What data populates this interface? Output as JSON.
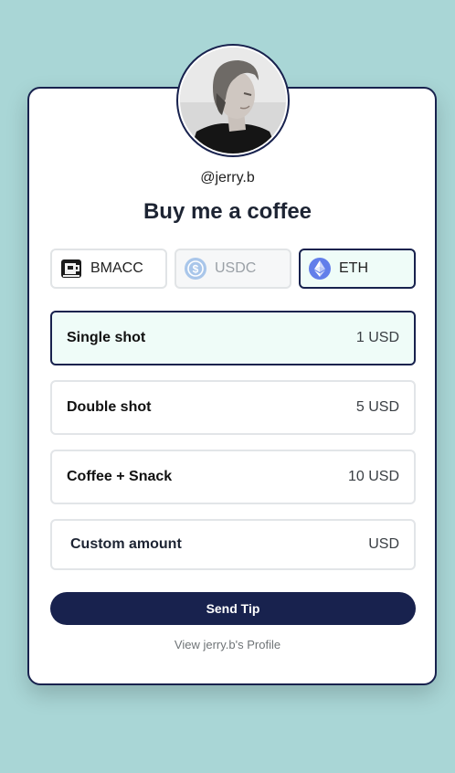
{
  "profile": {
    "handle": "@jerry.b"
  },
  "title": "Buy me a coffee",
  "tokens": [
    {
      "label": "BMACC",
      "icon": "coffee-cup-icon",
      "state": "default"
    },
    {
      "label": "USDC",
      "icon": "usdc-icon",
      "state": "disabled"
    },
    {
      "label": "ETH",
      "icon": "ethereum-icon",
      "state": "selected"
    }
  ],
  "options": [
    {
      "name": "Single shot",
      "price": "1 USD",
      "selected": true
    },
    {
      "name": "Double shot",
      "price": "5 USD",
      "selected": false
    },
    {
      "name": "Coffee + Snack",
      "price": "10 USD",
      "selected": false
    }
  ],
  "custom": {
    "placeholder": "Custom amount",
    "currency": "USD"
  },
  "actions": {
    "send_label": "Send Tip",
    "profile_link": "View jerry.b's Profile"
  },
  "colors": {
    "background": "#a9d6d6",
    "primary": "#18224e",
    "selected_bg": "#effcf8"
  }
}
